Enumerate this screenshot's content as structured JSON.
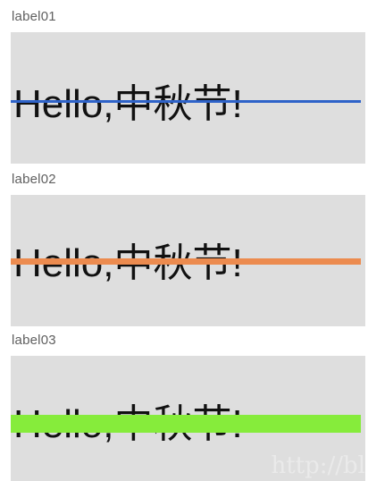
{
  "labels": [
    {
      "caption": "label01",
      "text": "Hello,中秋节!",
      "strike_color": "#2e63c9"
    },
    {
      "caption": "label02",
      "text": "Hello,中秋节!",
      "strike_color": "#ec8b4f"
    },
    {
      "caption": "label03",
      "text": "Hello,中秋节!",
      "strike_color": "#86ec3b"
    }
  ],
  "watermark": "http://bl"
}
